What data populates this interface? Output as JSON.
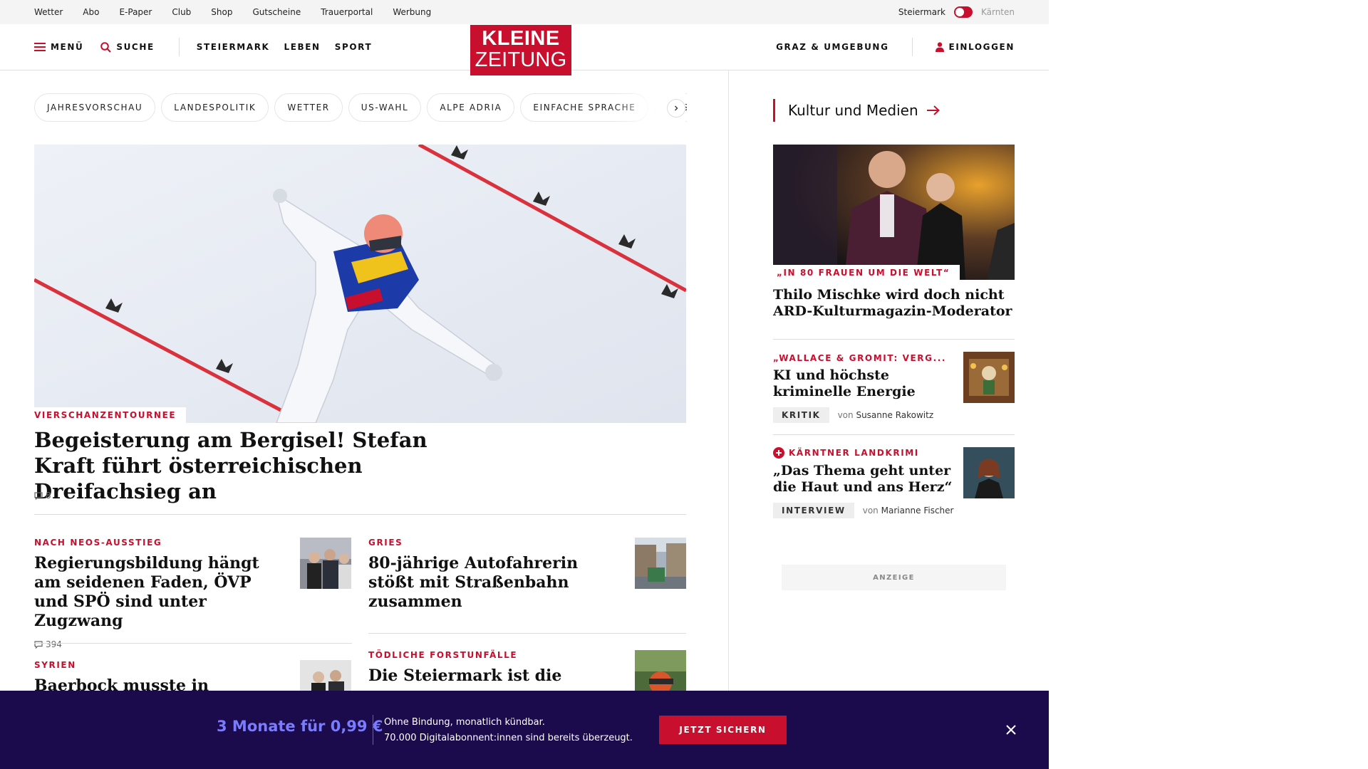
{
  "utility_bar": {
    "links": [
      "Wetter",
      "Abo",
      "E-Paper",
      "Club",
      "Shop",
      "Gutscheine",
      "Trauerportal",
      "Werbung"
    ],
    "region_active": "Steiermark",
    "region_inactive": "Kärnten"
  },
  "header": {
    "menu_label": "MENÜ",
    "search_label": "SUCHE",
    "nav": [
      "STEIERMARK",
      "LEBEN",
      "SPORT"
    ],
    "logo_line1": "KLEINE",
    "logo_line2": "ZEITUNG",
    "region_link": "GRAZ & UMGEBUNG",
    "login_label": "EINLOGGEN"
  },
  "tags": [
    "JAHRESVORSCHAU",
    "LANDESPOLITIK",
    "WETTER",
    "US-WAHL",
    "ALPE ADRIA",
    "EINFACHE SPRACHE",
    "DOSSIER"
  ],
  "hero": {
    "kicker": "VIERSCHANZENTOURNEE",
    "title": "Begeisterung am Bergisel! Stefan Kraft führt österreichischen Dreifachsieg an",
    "comments": "8"
  },
  "teasers": [
    {
      "kicker": "NACH NEOS-AUSSTIEG",
      "title": "Regierungsbildung hängt am seidenen Faden, ÖVP und SPÖ sind unter Zugzwang",
      "comments": "394"
    },
    {
      "kicker": "GRIES",
      "title": "80-jährige Autofahrerin stößt mit Straßenbahn zusammen"
    },
    {
      "kicker": "SYRIEN",
      "title": "Baerbock musste in Damaskus"
    },
    {
      "kicker": "TÖDLICHE FORSTUNFÄLLE",
      "title": "Die Steiermark ist die"
    }
  ],
  "sidebar": {
    "heading": "Kultur und Medien",
    "main": {
      "kicker": "„IN 80 FRAUEN UM DIE WELT“",
      "title": "Thilo Mischke wird doch nicht ARD-Kulturmagazin-Moderator"
    },
    "items": [
      {
        "kicker": "„WALLACE & GROMIT: VERG...",
        "title": "KI und höchste kriminelle Energie",
        "badge": "KRITIK",
        "by": "von",
        "author": "Susanne Rakowitz"
      },
      {
        "kicker": "KÄRNTNER LANDKRIMI",
        "title": "„Das Thema geht unter die Haut und ans Herz“",
        "badge": "INTERVIEW",
        "by": "von",
        "author": "Marianne Fischer"
      }
    ],
    "ad_label": "ANZEIGE"
  },
  "banner": {
    "offer": "3 Monate für 0,99 €",
    "line1": "Ohne Bindung, monatlich kündbar.",
    "line2": "70.000 Digitalabonnent:innen sind bereits überzeugt.",
    "cta": "JETZT SICHERN"
  },
  "colors": {
    "brand_red": "#c8102e",
    "banner_bg": "#1b0b4d",
    "offer_text": "#7a7cff"
  }
}
